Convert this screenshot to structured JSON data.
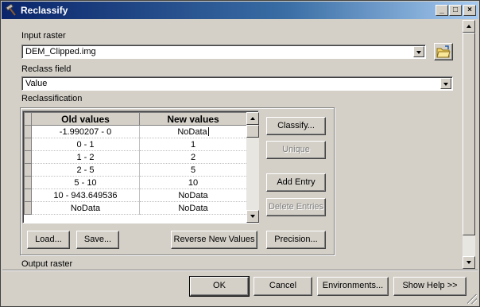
{
  "window": {
    "title": "Reclassify",
    "icon": "hammer-icon"
  },
  "input_raster": {
    "label": "Input raster",
    "value": "DEM_Clipped.img",
    "browse_icon": "open-folder-icon"
  },
  "reclass_field": {
    "label": "Reclass field",
    "value": "Value"
  },
  "reclassification": {
    "label": "Reclassification",
    "columns": [
      "Old values",
      "New values"
    ],
    "rows": [
      {
        "old": "-1.990207 - 0",
        "new": "NoData"
      },
      {
        "old": "0 - 1",
        "new": "1"
      },
      {
        "old": "1 - 2",
        "new": "2"
      },
      {
        "old": "2 - 5",
        "new": "5"
      },
      {
        "old": "5 - 10",
        "new": "10"
      },
      {
        "old": "10 - 943.649536",
        "new": "NoData"
      },
      {
        "old": "NoData",
        "new": "NoData"
      }
    ],
    "buttons": {
      "classify": "Classify...",
      "unique": "Unique",
      "add_entry": "Add Entry",
      "delete_entries": "Delete Entries",
      "load": "Load...",
      "save": "Save...",
      "reverse": "Reverse New Values",
      "precision": "Precision..."
    }
  },
  "output_raster": {
    "label": "Output raster"
  },
  "footer": {
    "ok": "OK",
    "cancel": "Cancel",
    "environments": "Environments...",
    "show_help": "Show Help >>"
  },
  "colors": {
    "title_start": "#0a246a",
    "title_end": "#a6caf0",
    "face": "#d4d0c8"
  }
}
